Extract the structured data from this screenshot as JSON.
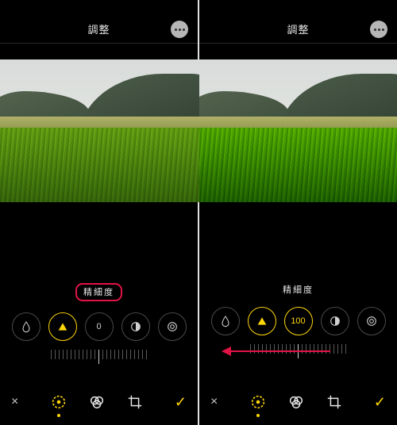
{
  "topbar": {
    "title": "調整"
  },
  "left": {
    "param_label": "精細度",
    "highlight": true,
    "center_value": "0",
    "active_dial_index": 1,
    "show_arrow": false
  },
  "right": {
    "param_label": "精細度",
    "highlight": false,
    "center_value": "100",
    "active_dial_index": 2,
    "show_arrow": true
  },
  "icons": {
    "more": "more",
    "adjust_tab": "adjust",
    "filters_tab": "filters",
    "crop_tab": "crop",
    "cancel": "×",
    "done": "✓"
  },
  "dial_icons": [
    "droplet",
    "triangle",
    "value",
    "half-circle",
    "ring"
  ]
}
